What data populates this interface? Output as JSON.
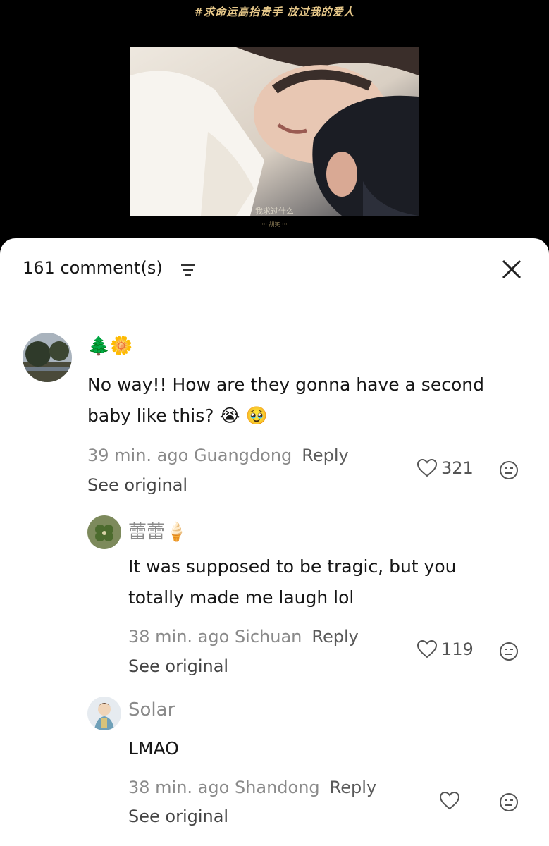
{
  "video": {
    "caption": "#求命运高抬贵手 放过我的爱人",
    "subtitle": "我求过什么",
    "watermark": "··· 胡笑 ···"
  },
  "header": {
    "comment_count": "161 comment(s)",
    "filter_icon": "filter-lines-icon",
    "close_icon": "close-x-icon"
  },
  "comments": [
    {
      "username": "🌲🌼",
      "text": "No way!! How are they gonna have a second baby like this? 😭 🥹",
      "time_location": "39 min. ago Guangdong",
      "reply_label": "Reply",
      "see_original": "See original",
      "likes": "321"
    },
    {
      "username": "蕾蕾🍦",
      "text": "It was supposed to be tragic, but you totally made me laugh lol",
      "time_location": "38 min. ago Sichuan",
      "reply_label": "Reply",
      "see_original": "See original",
      "likes": "119"
    },
    {
      "username": "Solar",
      "text": "LMAO",
      "time_location": "38 min. ago Shandong",
      "reply_label": "Reply",
      "see_original": "See original",
      "likes": ""
    }
  ],
  "colors": {
    "sheet_bg": "#ffffff",
    "muted_text": "#8a8a8a",
    "caption_gold": "#e8c98a"
  }
}
